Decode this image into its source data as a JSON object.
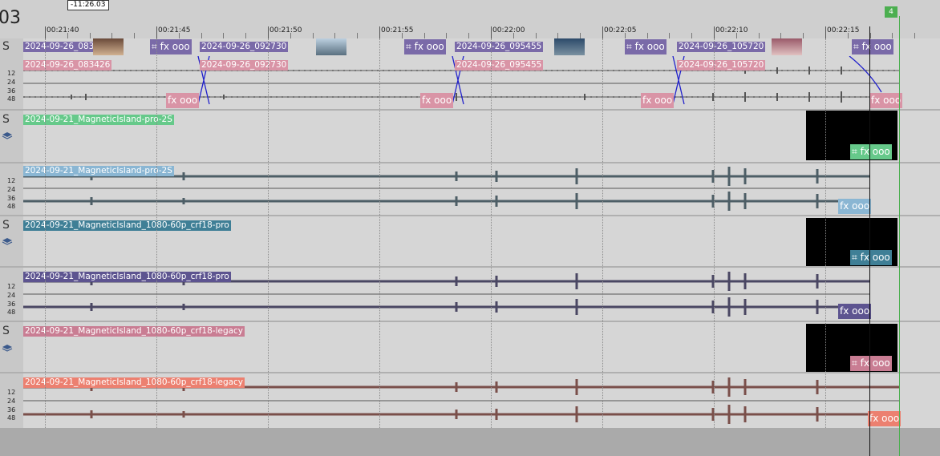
{
  "timeline": {
    "timecode_top": "-11:26.03",
    "timecode_big": "03",
    "marker": "4",
    "ticks": [
      "00:21:40",
      "00:21:45",
      "00:21:50",
      "00:21:55",
      "00:22:00",
      "00:22:05",
      "00:22:10",
      "00:22:15"
    ]
  },
  "headers": {
    "solo": "S",
    "db_scale": [
      "12",
      "24",
      "36",
      "48"
    ]
  },
  "tracks": {
    "t1_video_clips": [
      "2024-09-26_083426",
      "2024-09-26_092730",
      "2024-09-26_095455",
      "2024-09-26_105720"
    ],
    "t1_audio_clips": [
      "2024-09-26_083426",
      "2024-09-26_092730",
      "2024-09-26_095455",
      "2024-09-26_105720"
    ],
    "t2_video": "2024-09-21_MagneticIsland-pro-2S",
    "t2_audio": "2024-09-21_MagneticIsland-pro-2S",
    "t3_video": "2024-09-21_MagneticIsland_1080-60p_crf18-pro",
    "t3_audio": "2024-09-21_MagneticIsland_1080-60p_crf18-pro",
    "t4_video": "2024-09-21_MagneticIsland_1080-60p_crf18-legacy",
    "t4_audio": "2024-09-21_MagneticIsland_1080-60p_crf18-legacy"
  },
  "chip": {
    "fx": "fx",
    "more": "ooo"
  },
  "colors": {
    "purple": "#7a6aa8",
    "pink": "#d994a6",
    "green": "#66c98a",
    "blue": "#8ab6d3",
    "teal": "#3f7f96",
    "violet": "#5d5490",
    "rose": "#c97d93",
    "salmon": "#ec8070",
    "wave_t1": "#555",
    "wave_t2": "#4d5e66",
    "wave_t3": "#4a4763",
    "wave_t4": "#7a4f4a"
  }
}
